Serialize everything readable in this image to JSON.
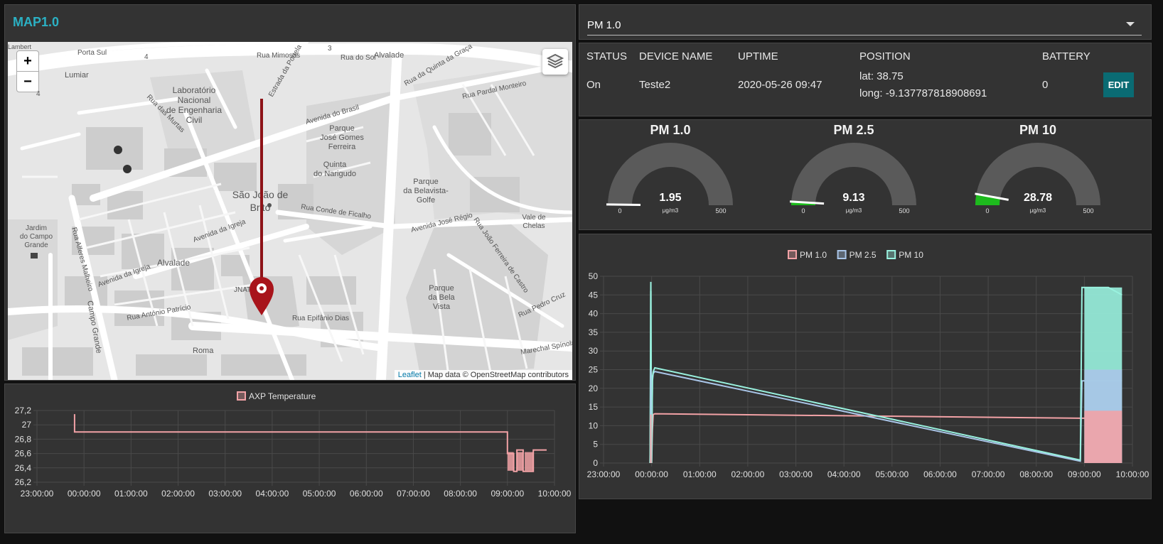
{
  "map_panel": {
    "title": "MAP1.0",
    "zoom_in": "+",
    "zoom_out": "−",
    "attribution_link": "Leaflet",
    "attribution_text": "| Map data © OpenStreetMap contributors",
    "labels": {
      "porta_sul": "Porta Sul",
      "rua_mimosas": "Rua Mimosas",
      "rua_do_sol": "Rua do Sol",
      "alvalade_top": "Alvalade",
      "lumiar": "Lumiar",
      "lambert": "Lambert",
      "laboratorio_1": "Laboratório",
      "laboratorio_2": "Nacional",
      "laboratorio_3": "de Engenharia",
      "laboratorio_4": "Civil",
      "avenida_do_brasil": "Avenida do Brasil",
      "rua_das_murtas": "Rua das Murtas",
      "estrada_da_portela": "Estrada da Portela",
      "rua_quinta_graca": "Rua da Quinta da Graça",
      "rua_pardal_monteiro": "Rua Pardal Monteiro",
      "parque_gomes_1": "Parque",
      "parque_gomes_2": "José Gomes",
      "parque_gomes_3": "Ferreira",
      "quinta_1": "Quinta",
      "quinta_2": "do Narigudo",
      "sao_joao_1": "São João de",
      "sao_joao_2": "Brito",
      "rua_conde_ficalho": "Rua Conde de Ficalho",
      "parque_belavista_1": "Parque",
      "parque_belavista_2": "da Belavista-",
      "parque_belavista_3": "Golfe",
      "avenida_jose_regio": "Avenida José Régio",
      "avenida_da_igreja": "Avenida da Igreja",
      "avenida_da_igreja_2": "Avenida da Igreja",
      "alvalade": "Alvalade",
      "jardim_1": "Jardim",
      "jardim_2": "do Campo",
      "jardim_3": "Grande",
      "rua_alferes_malheiro": "Rua Alferes Malheiro",
      "campo_grande": "Campo Grande",
      "jnatel": "JNATEL",
      "rua_epifanio_dias": "Rua Epifânio Dias",
      "parque_bela_vista_1": "Parque",
      "parque_bela_vista_2": "da Bela",
      "parque_bela_vista_3": "Vista",
      "vale_de_chelas_1": "Vale de",
      "vale_de_chelas_2": "Chelas",
      "roma": "Roma",
      "rua_antonio_patricio": "Rua António Patrício",
      "marechal_spinola": "Marechal Spínola",
      "rua_pedro_cruz": "Rua Pedro Cruz",
      "rua_joao_ferreira_castro": "Rua João Ferreira de Castro",
      "num_4": "4",
      "num_3": "3",
      "num_4b": "4"
    }
  },
  "selector": {
    "value": "PM 1.0"
  },
  "device_table": {
    "headers": {
      "status": "STATUS",
      "device_name": "DEVICE NAME",
      "uptime": "UPTIME",
      "position": "POSITION",
      "battery": "BATTERY"
    },
    "row": {
      "status": "On",
      "device_name": "Teste2",
      "uptime": "2020-05-26 09:47",
      "lat": "lat: 38.75",
      "long": "long: -9.137787818908691",
      "battery": "0"
    },
    "edit_label": "EDIT"
  },
  "gauges": [
    {
      "title": "PM 1.0",
      "value": 1.95,
      "value_label": "1.95",
      "unit": "μg/m3",
      "min": 0,
      "max": 500,
      "min_label": "0",
      "max_label": "500"
    },
    {
      "title": "PM 2.5",
      "value": 9.13,
      "value_label": "9.13",
      "unit": "μg/m3",
      "min": 0,
      "max": 500,
      "min_label": "0",
      "max_label": "500"
    },
    {
      "title": "PM 10",
      "value": 28.78,
      "value_label": "28.78",
      "unit": "μg/m3",
      "min": 0,
      "max": 500,
      "min_label": "0",
      "max_label": "500"
    }
  ],
  "colors": {
    "accent": "#2bb1c4",
    "gauge_track": "#5a5a5a",
    "gauge_fill": "#1dba1d",
    "pm1": "#f2a2a6",
    "pm25": "#a9c5e8",
    "pm10": "#99f2df",
    "temp": "#f2a2a6",
    "edit_button": "#0a6b73",
    "marker": "#a8141b"
  },
  "chart_data": [
    {
      "type": "line",
      "title": "",
      "xlabel": "",
      "ylabel": "",
      "x_ticks": [
        "23:00:00",
        "00:00:00",
        "01:00:00",
        "02:00:00",
        "03:00:00",
        "04:00:00",
        "05:00:00",
        "06:00:00",
        "07:00:00",
        "08:00:00",
        "09:00:00",
        "10:00:00"
      ],
      "y_ticks": [
        "26,2",
        "26,4",
        "26,6",
        "26,8",
        "27",
        "27,2"
      ],
      "ylim": [
        26.2,
        27.2
      ],
      "legend": "top",
      "grid": true,
      "series": [
        {
          "name": "AXP Temperature",
          "x": [
            "23:48",
            "23:48",
            "23:49",
            "09:00",
            "09:00",
            "09:08",
            "09:08",
            "09:12",
            "09:12",
            "09:20",
            "09:20",
            "09:33",
            "09:33",
            "09:50"
          ],
          "y": [
            27.15,
            26.9,
            26.9,
            26.9,
            26.6,
            26.6,
            26.35,
            26.35,
            26.65,
            26.65,
            26.35,
            26.35,
            26.65,
            26.65
          ]
        }
      ]
    },
    {
      "type": "line",
      "title": "",
      "xlabel": "",
      "ylabel": "",
      "x_ticks": [
        "23:00:00",
        "00:00:00",
        "01:00:00",
        "02:00:00",
        "03:00:00",
        "04:00:00",
        "05:00:00",
        "06:00:00",
        "07:00:00",
        "08:00:00",
        "09:00:00",
        "10:00:00"
      ],
      "y_ticks": [
        "0",
        "5",
        "10",
        "15",
        "20",
        "25",
        "30",
        "35",
        "40",
        "45",
        "50"
      ],
      "ylim": [
        0,
        50
      ],
      "legend": "top",
      "grid": true,
      "series": [
        {
          "name": "PM 1.0",
          "x": [
            "23:58",
            "23:59",
            "00:00",
            "00:01",
            "00:02",
            "00:04",
            "08:55",
            "08:57",
            "09:30",
            "09:47"
          ],
          "y": [
            0,
            14,
            0,
            9,
            13,
            13.2,
            12,
            12,
            12,
            12
          ]
        },
        {
          "name": "PM 2.5",
          "x": [
            "23:58",
            "23:59",
            "00:00",
            "00:01",
            "00:02",
            "00:04",
            "08:55",
            "08:57",
            "09:30",
            "09:47"
          ],
          "y": [
            0,
            27,
            0,
            22,
            24,
            24.5,
            0.5,
            22,
            22,
            22
          ]
        },
        {
          "name": "PM 10",
          "x": [
            "23:58",
            "23:59",
            "00:00",
            "00:01",
            "00:02",
            "00:04",
            "08:55",
            "08:57",
            "09:30",
            "09:47"
          ],
          "y": [
            0,
            48.5,
            0,
            23,
            24.5,
            25.5,
            0.8,
            47,
            47,
            45
          ]
        }
      ]
    }
  ]
}
